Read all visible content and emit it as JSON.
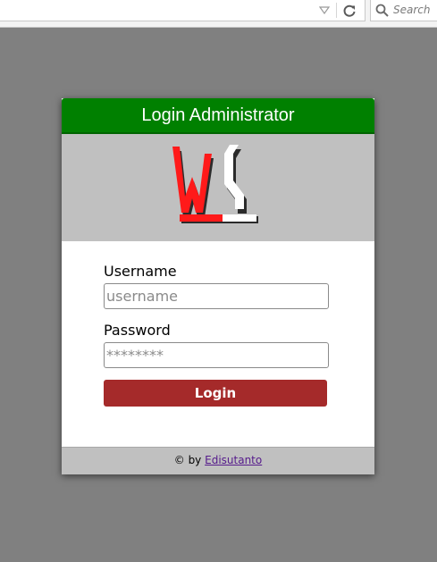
{
  "browser": {
    "search_placeholder": "Search"
  },
  "login": {
    "header_title": "Login Administrator",
    "username_label": "Username",
    "username_placeholder": "username",
    "password_label": "Password",
    "password_placeholder": "********",
    "submit_label": "Login"
  },
  "footer": {
    "prefix": "© by",
    "author_link": "Edisutanto"
  },
  "colors": {
    "page_bg": "#808080",
    "header_bg": "#008000",
    "logo_bg": "#c0c0c0",
    "button_bg": "#a52a2a",
    "logo_red": "#ff1a1a"
  }
}
